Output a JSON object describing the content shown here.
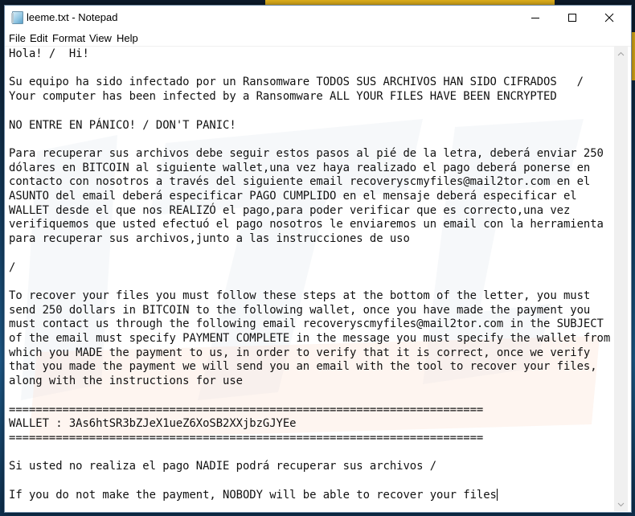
{
  "window": {
    "title": "leeme.txt - Notepad",
    "icon": "notepad-icon",
    "controls": {
      "minimize": "minimize-icon",
      "maximize": "maximize-icon",
      "close": "close-icon"
    }
  },
  "menubar": {
    "items": [
      {
        "label": "File"
      },
      {
        "label": "Edit"
      },
      {
        "label": "Format"
      },
      {
        "label": "View"
      },
      {
        "label": "Help"
      }
    ]
  },
  "document": {
    "lines": [
      "Hola! /  Hi!",
      "",
      "Su equipo ha sido infectado por un Ransomware TODOS SUS ARCHIVOS HAN SIDO CIFRADOS   /",
      "Your computer has been infected by a Ransomware ALL YOUR FILES HAVE BEEN ENCRYPTED",
      "",
      "NO ENTRE EN PÁNICO! / DON'T PANIC!",
      "",
      "Para recuperar sus archivos debe seguir estos pasos al pié de la letra, deberá enviar 250",
      "dólares en BITCOIN al siguiente wallet,una vez haya realizado el pago deberá ponerse en",
      "contacto con nosotros a través del siguiente email recoveryscmyfiles@mail2tor.com en el",
      "ASUNTO del email deberá especificar PAGO CUMPLIDO en el mensaje deberá especificar el",
      "WALLET desde el que nos REALIZÓ el pago,para poder verificar que es correcto,una vez",
      "verifiquemos que usted efectuó el pago nosotros le enviaremos un email con la herramienta",
      "para recuperar sus archivos,junto a las instrucciones de uso",
      "",
      "/",
      "",
      "To recover your files you must follow these steps at the bottom of the letter, you must",
      "send 250 dollars in BITCOIN to the following wallet, once you have made the payment you",
      "must contact us through the following email recoveryscmyfiles@mail2tor.com in the SUBJECT",
      "of the email must specify PAYMENT COMPLETE in the message you must specify the wallet from",
      "which you MADE the payment to us, in order to verify that it is correct, once we verify",
      "that you made the payment we will send you an email with the tool to recover your files,",
      "along with the instructions for use",
      "",
      "=======================================================================",
      "WALLET : 3As6htSR3bZJeX1ueZ6XoSB2XXjbzGJYEe",
      "=======================================================================",
      "",
      "Si usted no realiza el pago NADIE podrá recuperar sus archivos /",
      "",
      "If you do not make the payment, NOBODY will be able to recover your files"
    ]
  },
  "scrollbar": {
    "up_icon": "chevron-up-icon",
    "down_icon": "chevron-down-icon"
  },
  "colors": {
    "window_bg": "#ffffff",
    "text": "#111111",
    "scrollbar_bg": "#f0f0f0",
    "desktop_accent": "#e3b21c"
  }
}
